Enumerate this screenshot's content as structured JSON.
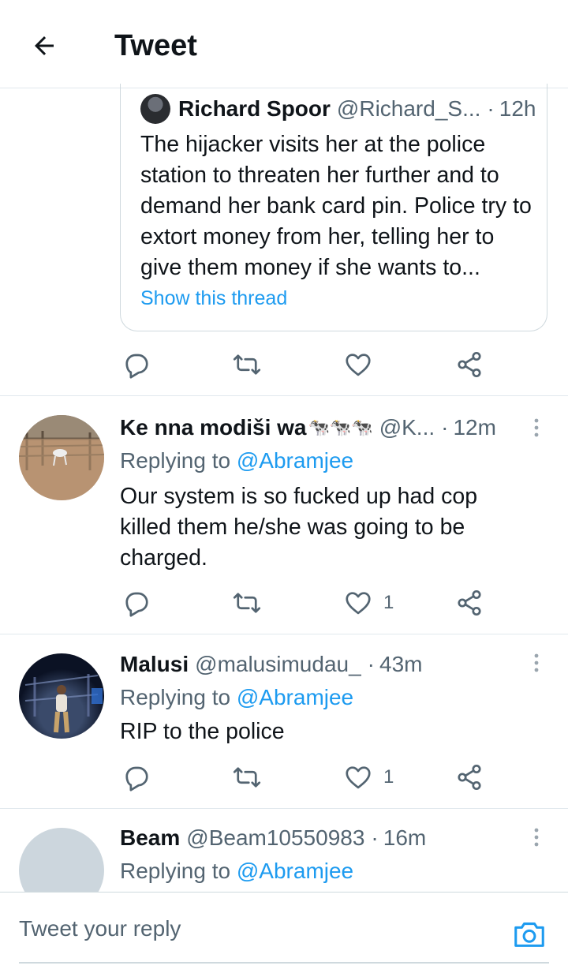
{
  "header": {
    "title": "Tweet"
  },
  "quoted_tweet": {
    "name": "Richard Spoor",
    "handle": "@Richard_S...",
    "dot": "·",
    "time": "12h",
    "text": "The hijacker visits her at the police station to threaten her further and to demand her bank card pin. Police try to extort money from her, telling her to give them money if she wants to...",
    "show_thread": "Show this thread"
  },
  "main_actions": {
    "like_count": ""
  },
  "tweets": [
    {
      "name": "Ke nna modiši wa",
      "name_emoji": "🐄🐄🐄",
      "handle": "@K...",
      "dot": "·",
      "time": "12m",
      "replying_prefix": "Replying to ",
      "replying_to": "@Abramjee",
      "text": "Our system is so fucked up had cop killed them he/she was going to be charged.",
      "like_count": "1"
    },
    {
      "name": "Malusi",
      "handle": "@malusimudau_",
      "dot": "·",
      "time": "43m",
      "replying_prefix": "Replying to ",
      "replying_to": "@Abramjee",
      "text": "RIP to the police",
      "like_count": "1"
    },
    {
      "name": "Beam",
      "handle": "@Beam10550983",
      "dot": "·",
      "time": "16m",
      "replying_prefix": "Replying to ",
      "replying_to": "@Abramjee"
    }
  ],
  "reply_bar": {
    "placeholder": "Tweet your reply"
  },
  "colors": {
    "accent": "#1d9bf0",
    "secondary_text": "#536471",
    "divider": "#e1e8ed"
  }
}
